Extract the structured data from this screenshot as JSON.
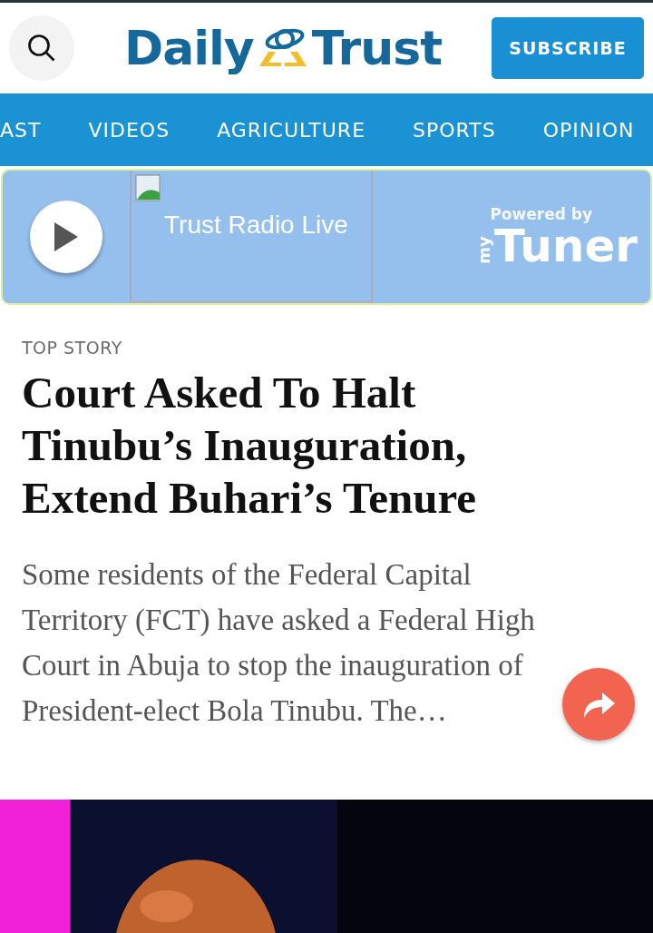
{
  "header": {
    "logo": {
      "left": "Daily",
      "right": "Trust"
    },
    "subscribe": "SUBSCRIBE"
  },
  "nav": [
    {
      "label": "AST",
      "selected": false
    },
    {
      "label": "VIDEOS",
      "selected": false
    },
    {
      "label": "AGRICULTURE",
      "selected": false
    },
    {
      "label": "SPORTS",
      "selected": false
    },
    {
      "label": "OPINION",
      "selected": false
    }
  ],
  "radio": {
    "title": "Trust Radio Live",
    "powered_by": "Powered by",
    "brand_small": "my",
    "brand": "Tuner"
  },
  "story": {
    "label": "TOP STORY",
    "headline": "Court Asked To Halt Tinubu’s Inauguration, Extend Buhari’s Tenure",
    "excerpt": "Some residents of the Federal Capital Territory (FCT) have asked a Federal High Court in Abuja to stop the inauguration of President-elect Bola Tinubu. The…"
  }
}
